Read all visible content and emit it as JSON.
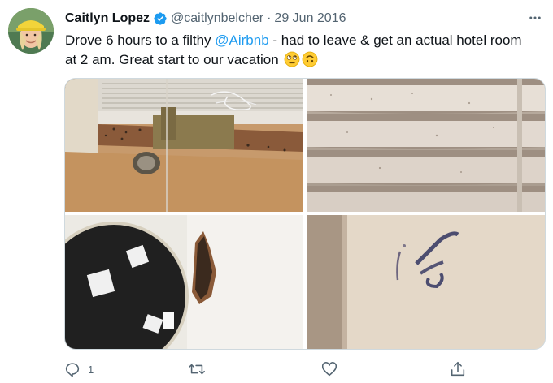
{
  "author": {
    "name": "Caitlyn Lopez",
    "handle": "@caitlynbelcher",
    "separator": "·",
    "date": "29 Jun 2016",
    "verified": true,
    "avatar_icon": "avatar-photo"
  },
  "tweet": {
    "text_part1": "Drove 6 hours to a filthy ",
    "mention": "@Airbnb",
    "text_part2": " - had to leave & get an actual hotel room at 2 am. Great start to our vacation",
    "emojis": [
      "rolling-eyes-emoji",
      "upside-down-face-emoji"
    ]
  },
  "media": {
    "images": [
      "dirty-window-sill-photo",
      "dusty-blinds-photo",
      "damaged-wall-photo",
      "stained-wall-photo"
    ]
  },
  "actions": {
    "reply_count": "1",
    "retweet_count": "",
    "like_count": ""
  },
  "colors": {
    "accent": "#1d9bf0",
    "secondary_text": "#536471",
    "primary_text": "#0f1419",
    "border": "#cfd9de"
  }
}
